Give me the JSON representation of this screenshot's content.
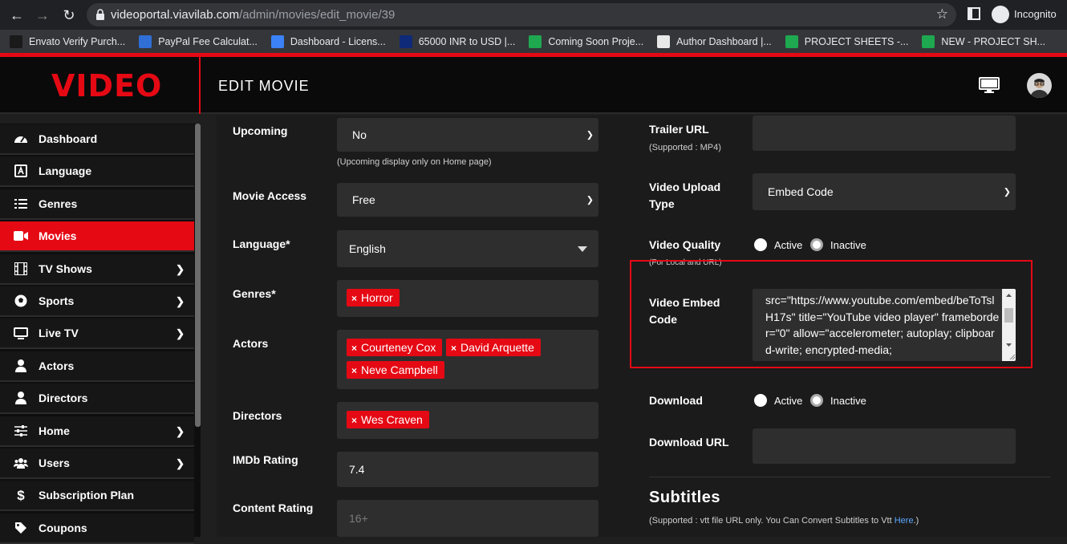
{
  "browser": {
    "url_host": "videoportal.viavilab.com",
    "url_path": "/admin/movies/edit_movie/39",
    "incognito_label": "Incognito",
    "bookmarks": [
      {
        "label": "Envato Verify Purch...",
        "color": "#1a1a1a"
      },
      {
        "label": "PayPal Fee Calculat...",
        "color": "#2f6fd6"
      },
      {
        "label": "Dashboard - Licens...",
        "color": "#3b82f6"
      },
      {
        "label": "65000 INR to USD |...",
        "color": "#0e2a78"
      },
      {
        "label": "Coming Soon Proje...",
        "color": "#1ea84f"
      },
      {
        "label": "Author Dashboard |...",
        "color": "#e8e8e8"
      },
      {
        "label": "PROJECT SHEETS -...",
        "color": "#1ea84f"
      },
      {
        "label": "NEW - PROJECT SH...",
        "color": "#1ea84f"
      }
    ]
  },
  "header": {
    "logo": "VIDEO",
    "title": "EDIT MOVIE"
  },
  "sidebar": {
    "items": [
      {
        "label": "Dashboard",
        "icon": "dashboard-icon",
        "chevron": false,
        "active": false
      },
      {
        "label": "Language",
        "icon": "language-icon",
        "chevron": false,
        "active": false
      },
      {
        "label": "Genres",
        "icon": "list-icon",
        "chevron": false,
        "active": false
      },
      {
        "label": "Movies",
        "icon": "video-camera-icon",
        "chevron": false,
        "active": true
      },
      {
        "label": "TV Shows",
        "icon": "film-icon",
        "chevron": true,
        "active": false
      },
      {
        "label": "Sports",
        "icon": "football-icon",
        "chevron": true,
        "active": false
      },
      {
        "label": "Live TV",
        "icon": "tv-icon",
        "chevron": true,
        "active": false
      },
      {
        "label": "Actors",
        "icon": "user-icon",
        "chevron": false,
        "active": false
      },
      {
        "label": "Directors",
        "icon": "user-icon",
        "chevron": false,
        "active": false
      },
      {
        "label": "Home",
        "icon": "sliders-icon",
        "chevron": true,
        "active": false
      },
      {
        "label": "Users",
        "icon": "users-icon",
        "chevron": true,
        "active": false
      },
      {
        "label": "Subscription Plan",
        "icon": "dollar-icon",
        "chevron": false,
        "active": false
      },
      {
        "label": "Coupons",
        "icon": "tag-icon",
        "chevron": false,
        "active": false
      }
    ]
  },
  "form_left": {
    "upcoming": {
      "label": "Upcoming",
      "value": "No",
      "help": "(Upcoming display only on Home page)"
    },
    "movie_access": {
      "label": "Movie Access",
      "value": "Free"
    },
    "language": {
      "label": "Language*",
      "value": "English"
    },
    "genres": {
      "label": "Genres*",
      "tags": [
        "Horror"
      ]
    },
    "actors": {
      "label": "Actors",
      "tags": [
        "Courteney Cox",
        "David Arquette",
        "Neve Campbell"
      ]
    },
    "directors": {
      "label": "Directors",
      "tags": [
        "Wes Craven"
      ]
    },
    "imdb": {
      "label": "IMDb Rating",
      "value": "7.4"
    },
    "content_rating": {
      "label": "Content Rating",
      "placeholder": "16+"
    }
  },
  "form_right": {
    "trailer": {
      "label": "Trailer URL",
      "help": "(Supported : MP4)"
    },
    "upload_type": {
      "label_line1": "Video Upload",
      "label_line2": "Type",
      "value": "Embed Code"
    },
    "quality": {
      "label": "Video Quality",
      "help": "(For Local and URL)",
      "opt_active": "Active",
      "opt_inactive": "Inactive",
      "selected": "Inactive"
    },
    "embed": {
      "label_line1": "Video Embed",
      "label_line2": "Code",
      "text": "src=\"https://www.youtube.com/embed/beToTslH17s\" title=\"YouTube video player\" frameborder=\"0\" allow=\"accelerometer; autoplay; clipboard-write; encrypted-media;"
    },
    "download": {
      "label": "Download",
      "opt_active": "Active",
      "opt_inactive": "Inactive",
      "selected": "Inactive"
    },
    "download_url": {
      "label": "Download URL"
    },
    "subtitles": {
      "title": "Subtitles",
      "help": "(Supported : vtt file URL only. You Can Convert Subtitles to Vtt ",
      "link": "Here",
      "help_end": ".)"
    }
  }
}
